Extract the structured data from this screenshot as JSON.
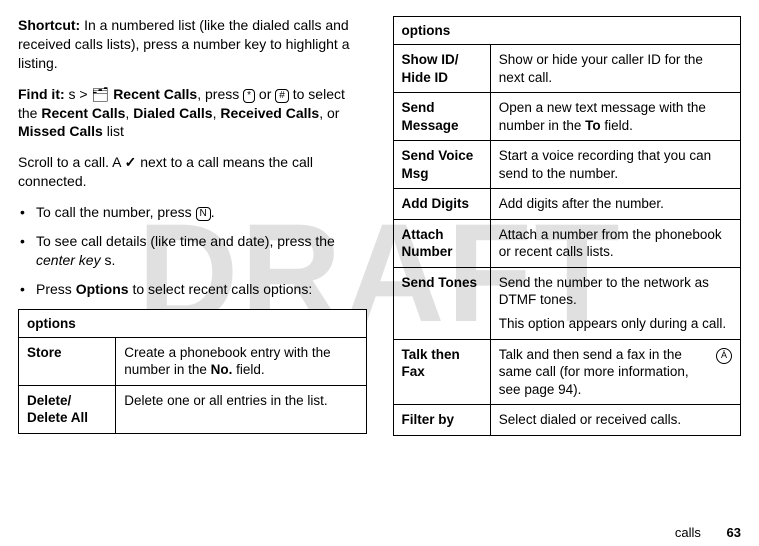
{
  "intro": {
    "shortcut_label": "Shortcut:",
    "shortcut_text": " In a numbered list (like the dialed calls and received calls lists), press a number key to highlight a listing.",
    "findit_label": "Find it:",
    "findit_prefix": " ",
    "nav_glyph": "s",
    "gt": " > ",
    "recent_icon": "🗂",
    "recent_calls": "Recent Calls",
    "press_word": ", press ",
    "key_star": "*",
    "or_word": " or ",
    "key_hash": "#",
    "to_select": " to select the ",
    "recent_calls2": "Recent Calls",
    "comma1": ", ",
    "dialed_calls": "Dialed Calls",
    "comma2": ", ",
    "received_calls": "Received Calls",
    "comma3": ", or ",
    "missed_calls": "Missed Calls",
    "list_word": " list",
    "scroll_text_a": "Scroll to a call. A ",
    "check": "✓",
    "scroll_text_b": " next to a call means the call connected."
  },
  "bullets": {
    "b1a": "To call the number, press ",
    "b1key": "N",
    "b1b": ".",
    "b2a": "To see call details (like time and date), press the ",
    "b2i": "center key",
    "b2glyph": " s",
    "b2b": ".",
    "b3a": "Press ",
    "b3bold": "Options",
    "b3b": " to select recent calls options:"
  },
  "table_left": {
    "caption": "options",
    "rows": [
      {
        "label": "Store",
        "desc_a": "Create a phonebook entry with the number in the ",
        "desc_bold": "No.",
        "desc_b": " field."
      },
      {
        "label": "Delete/ Delete All",
        "desc_a": "Delete one or all entries in the list.",
        "desc_bold": "",
        "desc_b": ""
      }
    ]
  },
  "table_right": {
    "caption": "options",
    "rows": [
      {
        "label": "Show ID/ Hide ID",
        "desc_a": "Show or hide your caller ID for the next call.",
        "desc_bold": "",
        "desc_b": ""
      },
      {
        "label": "Send Message",
        "desc_a": "Open a new text message with the number in the ",
        "desc_bold": "To",
        "desc_b": " field."
      },
      {
        "label": "Send Voice Msg",
        "desc_a": "Start a voice recording that you can send to the number.",
        "desc_bold": "",
        "desc_b": ""
      },
      {
        "label": "Add Digits",
        "desc_a": "Add digits after the number.",
        "desc_bold": "",
        "desc_b": ""
      },
      {
        "label": "Attach Number",
        "desc_a": "Attach a number from the phonebook or recent calls lists.",
        "desc_bold": "",
        "desc_b": ""
      },
      {
        "label": "Send Tones",
        "desc_a": "Send the number to the network as DTMF tones.",
        "desc_bold": "",
        "desc_b": "",
        "extra": "This option appears only during a call."
      },
      {
        "label": "Talk then Fax",
        "desc_a": "Talk and then send a fax in the same call (for more information, see page 94).",
        "desc_bold": "",
        "desc_b": "",
        "icon": true
      },
      {
        "label": "Filter by",
        "desc_a": "Select dialed or received calls.",
        "desc_bold": "",
        "desc_b": ""
      }
    ]
  },
  "footer": {
    "chapter": "calls",
    "page": "63"
  },
  "watermark": "DRAFT"
}
